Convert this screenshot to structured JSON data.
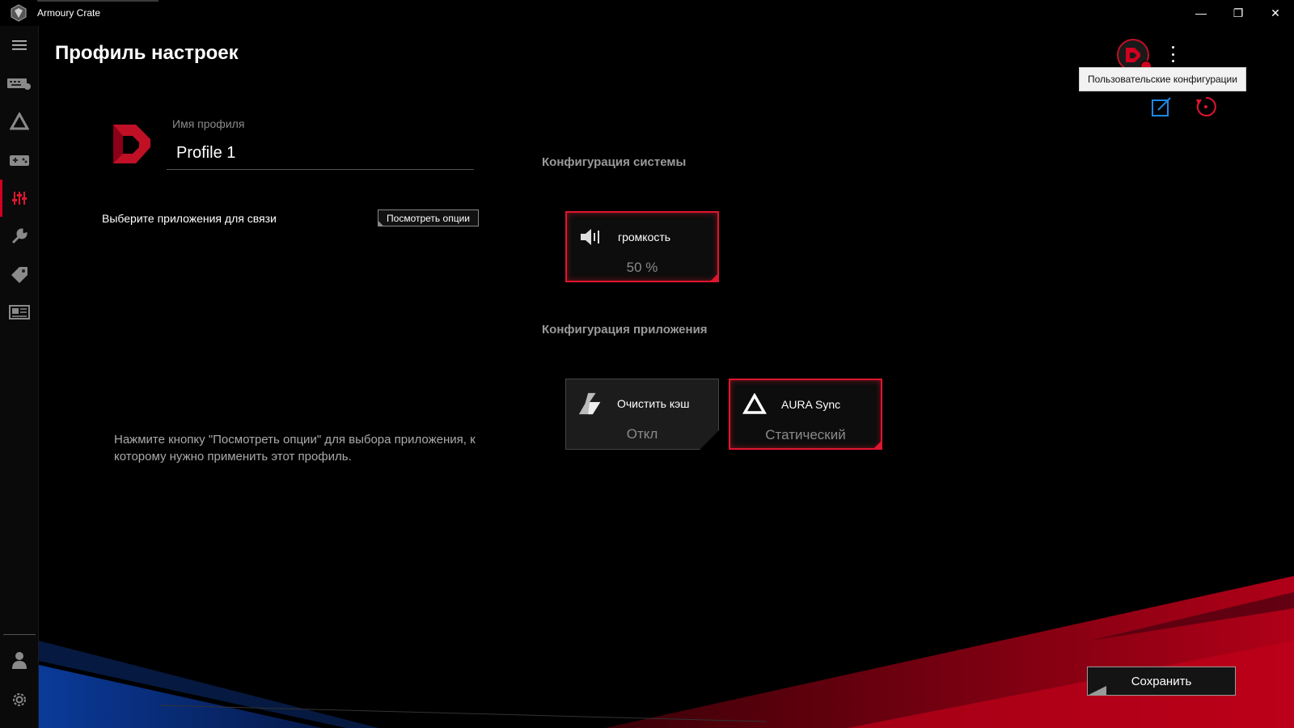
{
  "window": {
    "title": "Armoury Crate",
    "minimize": "—",
    "restore": "❐",
    "close": "✕"
  },
  "sidebar": {
    "items": [
      {
        "name": "menu",
        "icon": "hamburger-icon"
      },
      {
        "name": "devices",
        "icon": "keyboard-icon"
      },
      {
        "name": "aura",
        "icon": "aura-icon"
      },
      {
        "name": "game-library",
        "icon": "gamepad-icon"
      },
      {
        "name": "scenario-profiles",
        "icon": "sliders-icon",
        "active": true
      },
      {
        "name": "tools",
        "icon": "wrench-icon"
      },
      {
        "name": "deals",
        "icon": "tag-icon"
      },
      {
        "name": "news",
        "icon": "news-icon"
      },
      {
        "name": "user-center",
        "icon": "user-icon"
      },
      {
        "name": "settings",
        "icon": "gear-icon"
      }
    ]
  },
  "header": {
    "title": "Профиль настроек",
    "tooltip": "Пользовательские конфигурации"
  },
  "profile": {
    "name_label": "Имя профиля",
    "name_value": "Profile 1"
  },
  "apps": {
    "label": "Выберите приложения для связи",
    "view_options_button": "Посмотреть опции",
    "hint": "Нажмите кнопку \"Посмотреть опции\" для выбора приложения, к которому нужно применить этот профиль."
  },
  "system_config": {
    "title": "Конфигурация системы",
    "cards": [
      {
        "title": "громкость",
        "value": "50 %",
        "icon": "speaker-icon",
        "active": true
      }
    ]
  },
  "app_config": {
    "title": "Конфигурация приложения",
    "cards": [
      {
        "title": "Очистить кэш",
        "value": "Откл",
        "icon": "broom-icon",
        "active": false
      },
      {
        "title": "AURA Sync",
        "value": "Статический",
        "icon": "aura-sync-icon",
        "active": true
      }
    ]
  },
  "footer": {
    "save_button": "Сохранить"
  },
  "colors": {
    "accent": "#e0152e",
    "background": "#000000",
    "edit_icon": "#1e88e5"
  }
}
